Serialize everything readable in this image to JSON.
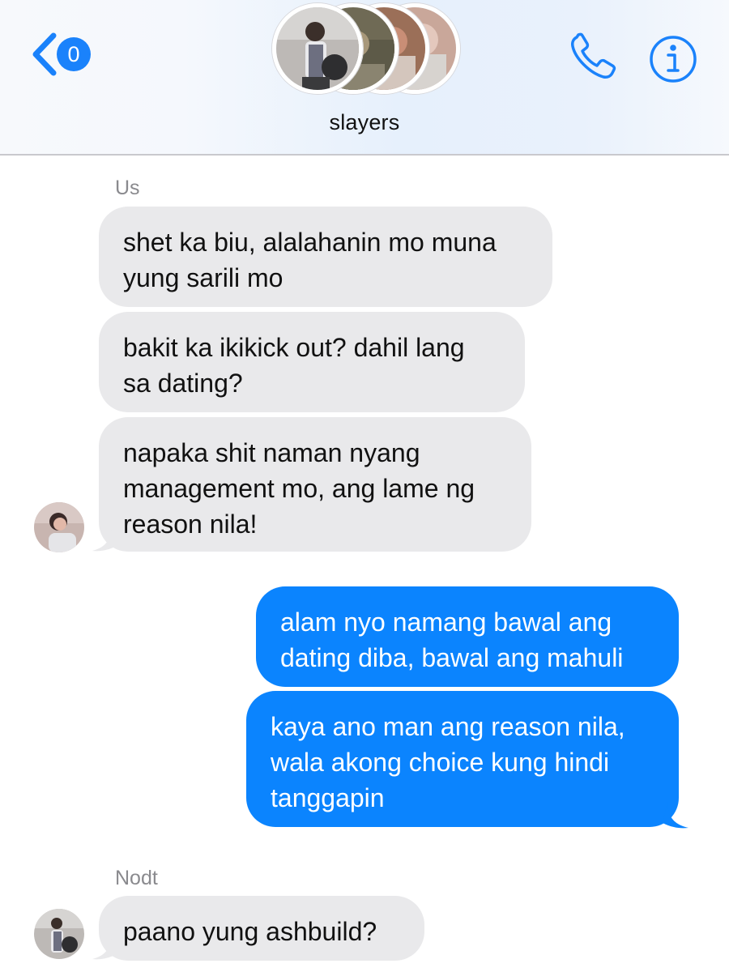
{
  "header": {
    "back_count": "0",
    "group_name": "slayers",
    "icons": {
      "back": "chevron-left-icon",
      "call": "phone-icon",
      "info": "info-icon"
    },
    "accent": "#1a82fb"
  },
  "messages": [
    {
      "sender": "Us",
      "direction": "incoming",
      "bubbles": [
        "shet ka biu, alalahanin mo muna\nyung sarili mo",
        "bakit ka ikikick out? dahil lang\nsa dating?",
        "napaka shit naman nyang\nmanagement mo, ang lame ng\nreason nila!"
      ]
    },
    {
      "sender": "",
      "direction": "outgoing",
      "bubbles": [
        "alam nyo namang bawal ang\ndating diba, bawal ang mahuli",
        "kaya ano man ang reason nila,\nwala akong choice kung hindi\ntanggapin"
      ]
    },
    {
      "sender": "Nodt",
      "direction": "incoming",
      "bubbles": [
        "paano yung ashbuild?"
      ]
    }
  ],
  "colors": {
    "incoming_bubble": "#e9e9eb",
    "outgoing_bubble": "#0b84fe"
  }
}
